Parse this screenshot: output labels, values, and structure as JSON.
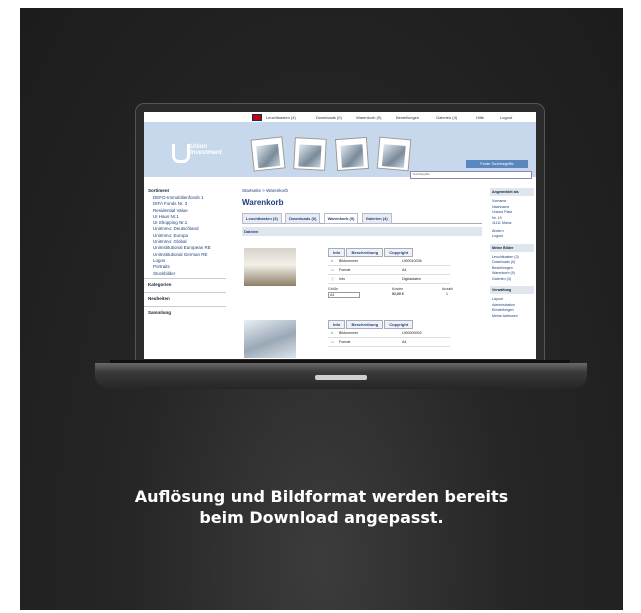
{
  "caption": {
    "line1": "Auflösung und Bildformat werden bereits",
    "line2": "beim Download angepasst."
  },
  "site": {
    "topbar": [
      "Leuchtkasten (4)",
      "Downloads (0)",
      "Warenkorb (9)",
      "Bestellungen",
      "Galerien (4)",
      "Hilfe",
      "Logout"
    ],
    "logo": {
      "line1": "Union",
      "line2": "Investment"
    },
    "search_button": "Feste Suchbegriffe",
    "search_placeholder": "Suchbegriffe",
    "left_nav": {
      "head": "Sortiment",
      "items": [
        "DEFO-Immobilienfonds 1",
        "DIFA Fonds Nr. 3",
        "Residential Value",
        "UI Haus Nr.1",
        "UI Shopping Nr.1",
        "UniImmo: Deutschland",
        "UniImmo: Europa",
        "UniImmo: Global",
        "UniInstitutional European RE",
        "UniInstitutional German RE",
        "Logos",
        "Portraits",
        "Stockbilder"
      ],
      "sections": [
        "Kategorien",
        "Neuheiten",
        "Sammlung"
      ]
    },
    "breadcrumb": "Startseite > Warenkorb",
    "page_title": "Warenkorb",
    "tabs": [
      "Leuchtkasten (3)",
      "Downloads (0)",
      "Warenkorb (9)",
      "Galerien (4)"
    ],
    "section": "Dateien",
    "info_tabs": [
      "Info",
      "Beschreibung",
      "Copyright"
    ],
    "item1": {
      "rows": [
        {
          "k": "Bildnummer",
          "v": "UI00010036"
        },
        {
          "k": "Format",
          "v": "A4"
        },
        {
          "k": "Info",
          "v": "Digitaldaten"
        }
      ],
      "groesse_label": "Größe",
      "groesse_value": "A4",
      "kosten_label": "Kosten",
      "kosten_value": "92,00 €",
      "anzahl_label": "Anzahl",
      "anzahl_value": "1"
    },
    "item2": {
      "rows": [
        {
          "k": "Bildnummer",
          "v": "UI00000002"
        },
        {
          "k": "Format",
          "v": "A4"
        }
      ]
    },
    "right_nav": {
      "head1": "Angemeldet als",
      "user_lines": [
        "Vorname",
        "Nachname",
        "Unions Platz",
        "Nr. 19",
        "11111 Mainz"
      ],
      "links1": [
        "Ändern",
        "Logout"
      ],
      "head2": "Meine Bilder",
      "links2": [
        "Leuchtkasten (3)",
        "Downloads (0)",
        "Bestellungen",
        "Warenkorb (9)",
        "Galerien (4)"
      ],
      "head3": "Verwaltung",
      "links3": [
        "Layout",
        "Administration",
        "Einstellungen",
        "Meine Adressen"
      ]
    }
  }
}
